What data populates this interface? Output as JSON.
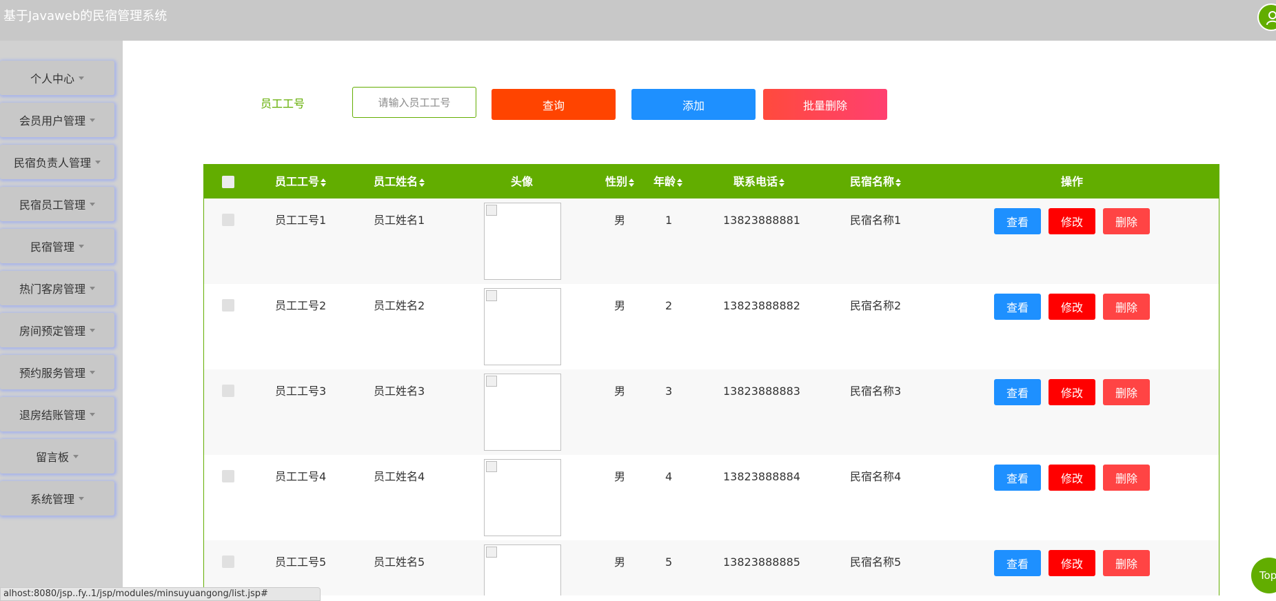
{
  "app": {
    "title": "基于Javaweb的民宿管理系统"
  },
  "sidebar": {
    "items": [
      {
        "label": "个人中心"
      },
      {
        "label": "会员用户管理"
      },
      {
        "label": "民宿负责人管理"
      },
      {
        "label": "民宿员工管理"
      },
      {
        "label": "民宿管理"
      },
      {
        "label": "热门客房管理"
      },
      {
        "label": "房间预定管理"
      },
      {
        "label": "预约服务管理"
      },
      {
        "label": "退房结账管理"
      },
      {
        "label": "留言板"
      },
      {
        "label": "系统管理"
      }
    ]
  },
  "search": {
    "label": "员工工号",
    "placeholder": "请输入员工工号",
    "query_label": "查询",
    "add_label": "添加",
    "batch_delete_label": "批量删除"
  },
  "table": {
    "headers": {
      "emp_no": "员工工号",
      "emp_name": "员工姓名",
      "avatar": "头像",
      "gender": "性别",
      "age": "年龄",
      "phone": "联系电话",
      "homestay": "民宿名称",
      "actions": "操作"
    },
    "rows": [
      {
        "emp_no": "员工工号1",
        "emp_name": "员工姓名1",
        "gender": "男",
        "age": "1",
        "phone": "13823888881",
        "homestay": "民宿名称1"
      },
      {
        "emp_no": "员工工号2",
        "emp_name": "员工姓名2",
        "gender": "男",
        "age": "2",
        "phone": "13823888882",
        "homestay": "民宿名称2"
      },
      {
        "emp_no": "员工工号3",
        "emp_name": "员工姓名3",
        "gender": "男",
        "age": "3",
        "phone": "13823888883",
        "homestay": "民宿名称3"
      },
      {
        "emp_no": "员工工号4",
        "emp_name": "员工姓名4",
        "gender": "男",
        "age": "4",
        "phone": "13823888884",
        "homestay": "民宿名称4"
      },
      {
        "emp_no": "员工工号5",
        "emp_name": "员工姓名5",
        "gender": "男",
        "age": "5",
        "phone": "13823888885",
        "homestay": "民宿名称5"
      }
    ],
    "row_actions": {
      "view": "查看",
      "edit": "修改",
      "delete": "删除"
    }
  },
  "statusbar": {
    "text": "alhost:8080/jsp..fy..1/jsp/modules/minsuyuangong/list.jsp#"
  },
  "top_button": {
    "label": "Top"
  },
  "colors": {
    "accent": "#62ad00",
    "query": "#ff4400",
    "add": "#1e90ff",
    "edit": "#ff0000",
    "delete": "#ff4444"
  },
  "icons": {
    "user": "user-icon",
    "caret": "caret-down-icon",
    "sort": "sort-icon"
  }
}
